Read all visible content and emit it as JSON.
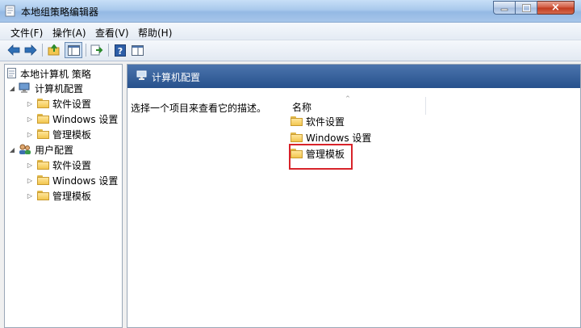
{
  "window": {
    "title": "本地组策略编辑器",
    "controls": {
      "minimize": "minimize",
      "maximize": "maximize",
      "close": "×"
    }
  },
  "menu": [
    "文件(F)",
    "操作(A)",
    "查看(V)",
    "帮助(H)"
  ],
  "toolbar": {
    "icons": [
      "back-arrow-icon",
      "forward-arrow-icon",
      "up-folder-icon",
      "show-hide-tree-icon",
      "export-list-icon",
      "help-icon",
      "properties-icon"
    ]
  },
  "tree": {
    "root": "本地计算机 策略",
    "computer_config": {
      "label": "计算机配置",
      "children": [
        "软件设置",
        "Windows 设置",
        "管理模板"
      ]
    },
    "user_config": {
      "label": "用户配置",
      "children": [
        "软件设置",
        "Windows 设置",
        "管理模板"
      ]
    }
  },
  "details": {
    "header_title": "计算机配置",
    "description": "选择一个项目来查看它的描述。",
    "column_name": "名称",
    "items": [
      "软件设置",
      "Windows 设置",
      "管理模板"
    ]
  },
  "colors": {
    "title_bar": "#a9c9ec",
    "pane_header": "#3a629b",
    "highlight": "#d8232a",
    "folder": "#f2c64f"
  }
}
